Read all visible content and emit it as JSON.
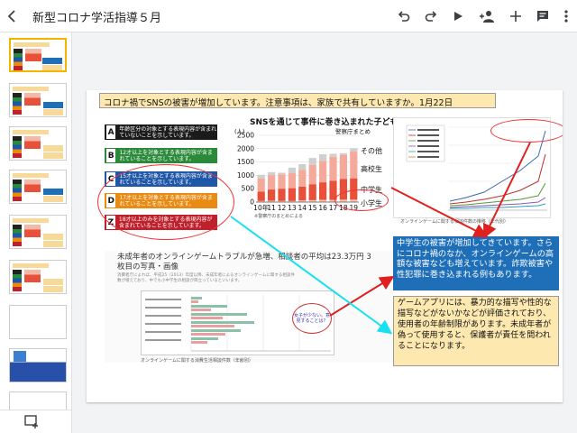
{
  "topbar": {
    "title": "新型コロナ学活指導５月",
    "icons": [
      "back-arrow-icon",
      "undo-icon",
      "redo-icon",
      "play-icon",
      "add-person-icon",
      "plus-icon",
      "comment-icon",
      "more-vert-icon"
    ]
  },
  "filmstrip": {
    "selected_index": 1,
    "thumbnail_labels": [
      "1"
    ]
  },
  "slide": {
    "title": "コロナ禍でSNSの被害が増加しています。注意事項は、家族で共有していますか。1月22日",
    "ratings": [
      {
        "mark": "A",
        "label": "年齢区分の対象とする表現内容が含まれていないことを示しています。",
        "color": "#1b1b1b"
      },
      {
        "mark": "B",
        "label": "12才以上を対象とする表現内容が含まれていることを示しています。",
        "color": "#2a8a3a"
      },
      {
        "mark": "C",
        "label": "15才以上を対象とする表現内容が含まれていることを示しています。",
        "color": "#1e56a8"
      },
      {
        "mark": "D",
        "label": "17才以上を対象とする表現内容が含まれていることを示しています。",
        "color": "#e98a12"
      },
      {
        "mark": "Z",
        "label": "18才以上のみを対象とする表現内容が含まれていることを示しています。",
        "color": "#c0202c"
      }
    ],
    "blue_box": "中学生の被害が増加してきています。さらにコロナ禍のなか、オンラインゲームの高額な被害なども増えています。詐欺被害や性犯罪に巻き込まれる例もあります。",
    "yellow_box": "ゲームアプリには、暴力的な描写や性的な描写などがないかなどが評価されており、使用者の年齢制限があります。未成年者が偽って使用すると、保護者が責任を問われることになります。",
    "lower_heading": "未成年者のオンラインゲームトラブルが急増、相談者の平均は23.3万円 3枚目の写真・画像",
    "lower_body": "消費者庁によれば、平成25（2013）年度以降、未成年者によるオンラインゲームに関する相談件数が増えており、中でも小中学生の相談が目立っているといいます。",
    "callout": "女子が少ない。意見することは？",
    "line_caption": "オンラインゲームに関する相談件数の推移（年代別）",
    "hbar_caption": "オンラインゲームに関する消費生活相談件数（年齢別）",
    "chart_caption": "※警察庁のまとめによる"
  },
  "chart_data": {
    "type": "bar",
    "title": "SNSを通じて事件に巻き込まれた子ども",
    "source": "警察庁まとめ",
    "unit": "(人)",
    "xlabel": "",
    "ylabel": "",
    "categories": [
      "10年",
      "11",
      "12",
      "13",
      "14",
      "15",
      "16",
      "17",
      "18",
      "19"
    ],
    "ylim": [
      0,
      2500
    ],
    "yticks": [
      0,
      500,
      1000,
      1500,
      2000,
      2500
    ],
    "series": [
      {
        "name": "小学生",
        "values": [
          40,
          50,
          40,
          40,
          60,
          70,
          80,
          80,
          90,
          90
        ],
        "color": "#f3c3b4"
      },
      {
        "name": "中学生",
        "values": [
          350,
          420,
          460,
          480,
          520,
          600,
          660,
          720,
          780,
          800
        ],
        "color": "#e8503a"
      },
      {
        "name": "高校生",
        "values": [
          500,
          540,
          540,
          560,
          620,
          720,
          800,
          900,
          900,
          1000
        ],
        "color": "#f5a99a"
      },
      {
        "name": "その他",
        "values": [
          130,
          110,
          60,
          210,
          220,
          260,
          250,
          110,
          60,
          130
        ],
        "color": "#cfcfcf"
      }
    ],
    "legend": "right"
  }
}
